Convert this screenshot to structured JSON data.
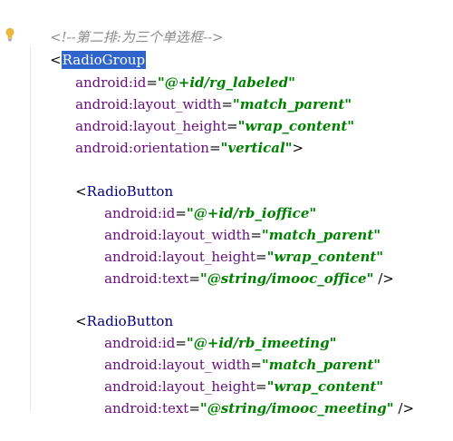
{
  "editor": {
    "comment": "<!--第二排:为三个单选框-->",
    "radio_group": {
      "tag": "RadioGroup",
      "attrs": [
        {
          "name": "android:id",
          "value": "@+id/rg_labeled"
        },
        {
          "name": "android:layout_width",
          "value": "match_parent"
        },
        {
          "name": "android:layout_height",
          "value": "wrap_content"
        },
        {
          "name": "android:orientation",
          "value": "vertical"
        }
      ],
      "close": ">"
    },
    "buttons": [
      {
        "tag": "RadioButton",
        "attrs": [
          {
            "name": "android:id",
            "value": "@+id/rb_ioffice"
          },
          {
            "name": "android:layout_width",
            "value": "match_parent"
          },
          {
            "name": "android:layout_height",
            "value": "wrap_content"
          },
          {
            "name": "android:text",
            "value": "@string/imooc_office"
          }
        ],
        "close": " />"
      },
      {
        "tag": "RadioButton",
        "attrs": [
          {
            "name": "android:id",
            "value": "@+id/rb_imeeting"
          },
          {
            "name": "android:layout_width",
            "value": "match_parent"
          },
          {
            "name": "android:layout_height",
            "value": "wrap_content"
          },
          {
            "name": "android:text",
            "value": "@string/imooc_meeting"
          }
        ],
        "close": " />"
      }
    ]
  },
  "gutter": {
    "icon": "lightbulb-icon",
    "bulb_color": "#e8b93b"
  },
  "colors": {
    "tag": "#000080",
    "attribute": "#660e7a",
    "value": "#008000",
    "comment": "#8c8c8c",
    "selection": "#2f65ca"
  }
}
